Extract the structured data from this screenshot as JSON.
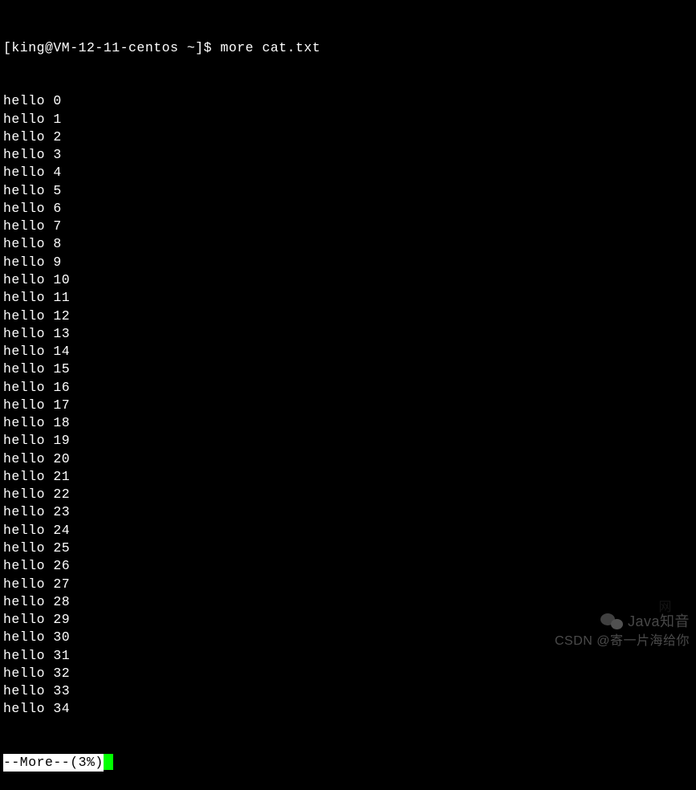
{
  "prompt": {
    "user_host": "[king@VM-12-11-centos ~]$",
    "command": "more cat.txt"
  },
  "lines": [
    "hello 0",
    "hello 1",
    "hello 2",
    "hello 3",
    "hello 4",
    "hello 5",
    "hello 6",
    "hello 7",
    "hello 8",
    "hello 9",
    "hello 10",
    "hello 11",
    "hello 12",
    "hello 13",
    "hello 14",
    "hello 15",
    "hello 16",
    "hello 17",
    "hello 18",
    "hello 19",
    "hello 20",
    "hello 21",
    "hello 22",
    "hello 23",
    "hello 24",
    "hello 25",
    "hello 26",
    "hello 27",
    "hello 28",
    "hello 29",
    "hello 30",
    "hello 31",
    "hello 32",
    "hello 33",
    "hello 34"
  ],
  "more_status": "--More--(3%)",
  "watermarks": {
    "top_right": "Java知音",
    "bottom_right": "CSDN @寄一片海给你",
    "faint": "网"
  }
}
